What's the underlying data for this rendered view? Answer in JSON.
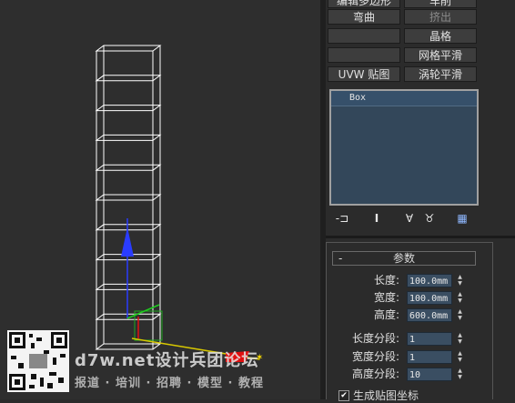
{
  "modifiers": {
    "row0_left": "编辑多边形",
    "row0_right": "车削",
    "row1_left": "弯曲",
    "row1_right": "挤出",
    "row2_left": "",
    "row2_right": "晶格",
    "row3_left": "",
    "row3_right": "网格平滑",
    "row4_left": "UVW 贴图",
    "row4_right": "涡轮平滑"
  },
  "stack": {
    "item": "Box"
  },
  "toolbar": {
    "pin_icon": "-⊐",
    "show_end_icon": "I",
    "unique_icon": "∀",
    "remove_icon": "♉",
    "configure_icon": "▦"
  },
  "rollout": {
    "title": "参数",
    "collapse": "-"
  },
  "params": {
    "length_label": "长度:",
    "length_value": "100.0mm",
    "width_label": "宽度:",
    "width_value": "100.0mm",
    "height_label": "高度:",
    "height_value": "600.0mm",
    "length_segs_label": "长度分段:",
    "length_segs_value": "1",
    "width_segs_label": "宽度分段:",
    "width_segs_value": "1",
    "height_segs_label": "高度分段:",
    "height_segs_value": "10"
  },
  "checkbox": {
    "label": "生成贴图坐标",
    "checked": "✔"
  },
  "watermark": {
    "site": "d7w.net设计兵团论坛",
    "tagline": "报道 · 培训 · 招聘 · 模型 · 教程"
  },
  "colors": {
    "viewport_bg": "#2e2e2e",
    "panel_bg": "#2b2b2b",
    "stack_bg": "#33475a",
    "wire": "#ffffff"
  }
}
